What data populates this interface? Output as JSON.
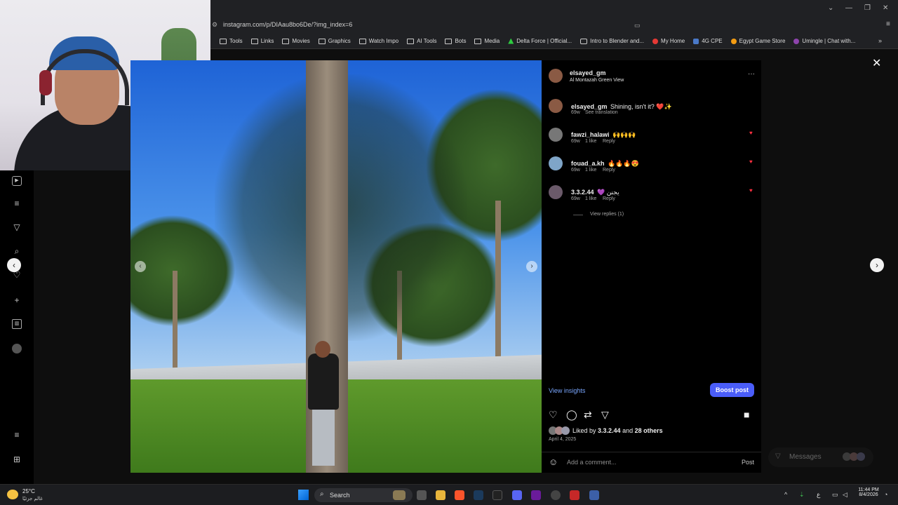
{
  "browser": {
    "url": "instagram.com/p/DIAau8bo6De/?img_index=6",
    "bookmarks": [
      "Tools",
      "Links",
      "Movies",
      "Graphics",
      "Watch Impo",
      "AI Tools",
      "Bots",
      "Media",
      "Delta Force | Official...",
      "Intro to Blender and...",
      "My Home",
      "4G CPE",
      "Egypt Game Store",
      "Umingle | Chat with..."
    ],
    "more_label": "»"
  },
  "post": {
    "author": "elsayed_gm",
    "location": "Al Montazah Green View",
    "caption_user": "elsayed_gm",
    "caption": "Shining, isn't it? ❤️✨",
    "caption_time": "69w",
    "see_translation": "See translation",
    "comments": [
      {
        "user": "fawzi_halawi",
        "text": "🙌🙌🙌",
        "time": "69w",
        "likes": "1 like",
        "reply": "Reply"
      },
      {
        "user": "fouad_a.kh",
        "text": "🔥🔥🔥😍",
        "time": "69w",
        "likes": "1 like",
        "reply": "Reply"
      },
      {
        "user": "3.3.2.44",
        "text": "💜 يجنن",
        "time": "69w",
        "likes": "1 like",
        "reply": "Reply"
      }
    ],
    "view_replies": "View replies (1)",
    "view_insights": "View insights",
    "boost_post": "Boost post",
    "liked_prefix": "Liked by ",
    "liked_user": "3.3.2.44",
    "liked_and": " and ",
    "liked_others": "28 others",
    "date": "April 4, 2025",
    "add_comment_placeholder": "Add a comment...",
    "post_button": "Post",
    "more_options": "···"
  },
  "messages_label": "Messages",
  "taskbar": {
    "temperature": "25°C",
    "weather_desc": "غالم جزئيًا",
    "search_label": "Search",
    "language": "ع",
    "time": "11:44 PM",
    "date": "8/4/2026"
  },
  "colors": {
    "accent": "#4a5df9",
    "link": "#7aa7ff",
    "like": "#ff3040"
  }
}
